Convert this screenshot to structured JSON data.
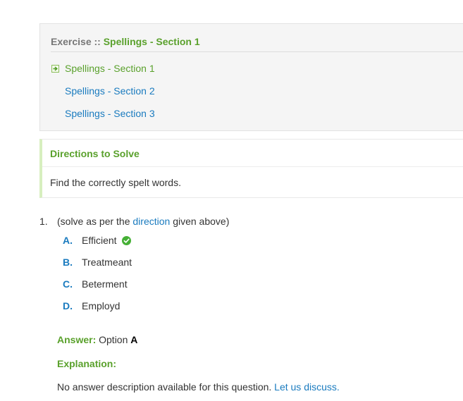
{
  "exercise": {
    "prefix": "Exercise",
    "separator": " :: ",
    "current": "Spellings - Section 1",
    "sections": [
      {
        "label": "Spellings - Section 1"
      },
      {
        "label": "Spellings - Section 2"
      },
      {
        "label": "Spellings - Section 3"
      }
    ]
  },
  "directions": {
    "title": "Directions to Solve",
    "text": "Find the correctly spelt words."
  },
  "question": {
    "number": "1.",
    "text_before": "(solve as per the ",
    "link": "direction",
    "text_after": " given above)",
    "options": [
      {
        "letter": "A.",
        "text": "Efficient",
        "correct_icon": "check-circle-icon"
      },
      {
        "letter": "B.",
        "text": "Treatmeant"
      },
      {
        "letter": "C.",
        "text": "Beterment"
      },
      {
        "letter": "D.",
        "text": "Employd"
      }
    ]
  },
  "answer": {
    "label": "Answer:",
    "text": " Option ",
    "option": "A"
  },
  "explanation": {
    "label": "Explanation:",
    "text": "No answer description available for this question. ",
    "link": "Let us discuss."
  },
  "colors": {
    "green": "#5aa12c",
    "blue": "#1a7bbf",
    "check": "#45b035"
  }
}
